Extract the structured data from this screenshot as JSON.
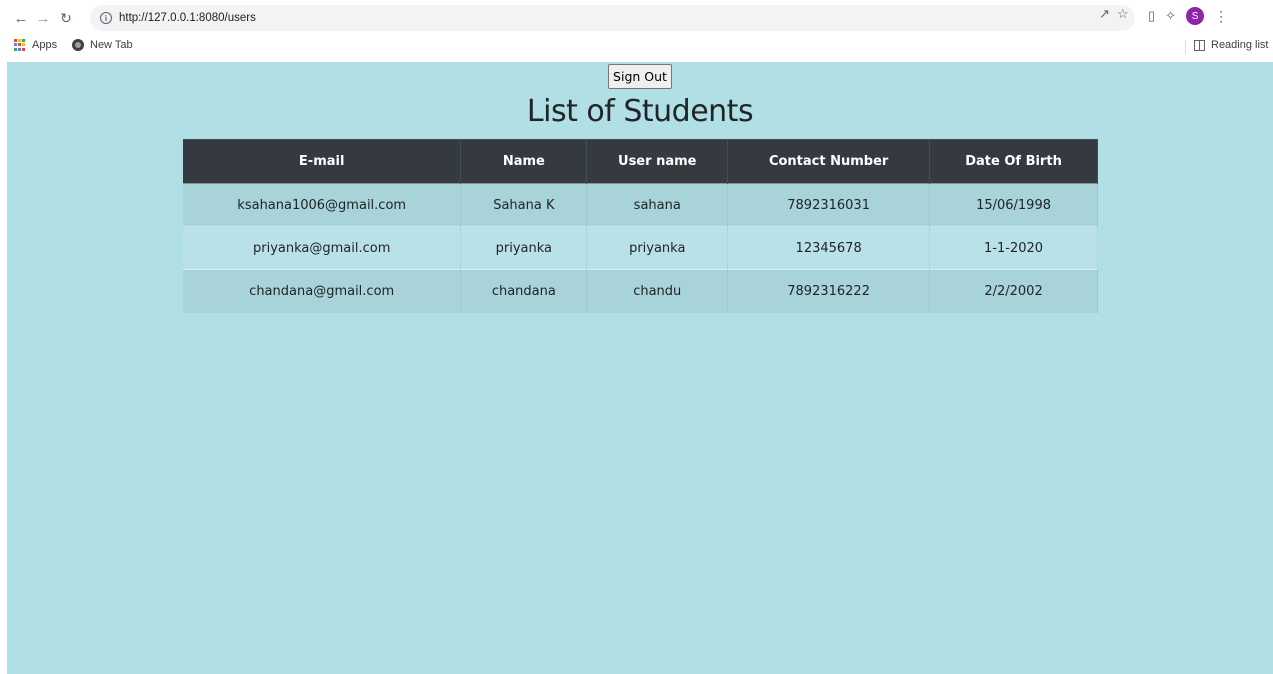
{
  "browser": {
    "url": "http://127.0.0.1:8080/users",
    "avatar_letter": "S",
    "avatar_color": "#8e24aa",
    "bookmarks": {
      "apps_label": "Apps",
      "newtab_label": "New Tab",
      "reading_list_label": "Reading list"
    }
  },
  "page": {
    "background_color": "#b0dfe5",
    "signout_label": "Sign Out",
    "title": "List of Students",
    "table": {
      "header_color": "#343a40",
      "columns": [
        "E-mail",
        "Name",
        "User name",
        "Contact Number",
        "Date Of Birth"
      ],
      "rows": [
        [
          "ksahana1006@gmail.com",
          "Sahana K",
          "sahana",
          "7892316031",
          "15/06/1998"
        ],
        [
          "priyanka@gmail.com",
          "priyanka",
          "priyanka",
          "12345678",
          "1-1-2020"
        ],
        [
          "chandana@gmail.com",
          "chandana",
          "chandu",
          "7892316222",
          "2/2/2002"
        ]
      ]
    }
  }
}
